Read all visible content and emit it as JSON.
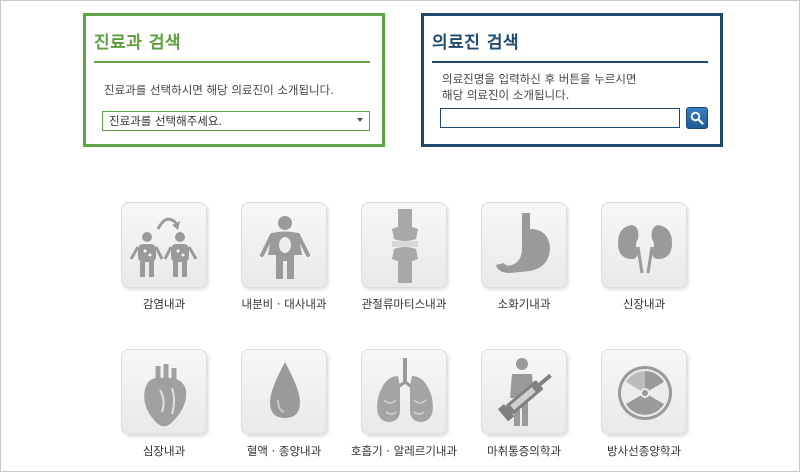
{
  "dept_search": {
    "title": "진료과 검색",
    "description": "진료과를 선택하시면 해당 의료진이 소개됩니다.",
    "select_value": "진료과를 선택해주세요."
  },
  "doctor_search": {
    "title": "의료진 검색",
    "description_line1": "의료진명을 입력하신 후 버튼을 누르시면",
    "description_line2": "해당 의료진이 소개됩니다.",
    "input_value": "",
    "input_placeholder": ""
  },
  "departments": [
    {
      "label": "감염내과",
      "icon": "infection-people-icon"
    },
    {
      "label": "내분비 · 대사내과",
      "icon": "body-organ-icon"
    },
    {
      "label": "관절류마티스내과",
      "icon": "knee-joint-icon"
    },
    {
      "label": "소화기내과",
      "icon": "stomach-icon"
    },
    {
      "label": "신장내과",
      "icon": "kidney-icon"
    },
    {
      "label": "심장내과",
      "icon": "heart-icon"
    },
    {
      "label": "혈액 · 종양내과",
      "icon": "blood-drop-icon"
    },
    {
      "label": "호흡기 · 알레르기내과",
      "icon": "lungs-icon"
    },
    {
      "label": "마취통증의학과",
      "icon": "syringe-icon"
    },
    {
      "label": "방사선종양학과",
      "icon": "radiation-icon"
    }
  ],
  "colors": {
    "dept_accent": "#5fa247",
    "doctor_accent": "#1f4a6e",
    "icon_gray": "#9a9a9a"
  }
}
